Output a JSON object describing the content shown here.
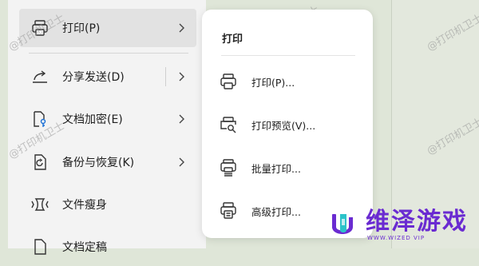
{
  "menu": {
    "items": [
      {
        "label": "打印(P)",
        "icon": "printer-icon",
        "has_submenu": true,
        "active": true
      },
      {
        "label": "分享发送(D)",
        "icon": "share-icon",
        "has_submenu": true,
        "active": false
      },
      {
        "label": "文档加密(E)",
        "icon": "document-lock-icon",
        "has_submenu": true,
        "active": false
      },
      {
        "label": "备份与恢复(K)",
        "icon": "backup-icon",
        "has_submenu": true,
        "active": false
      },
      {
        "label": "文件瘦身",
        "icon": "file-slim-icon",
        "has_submenu": false,
        "active": false
      },
      {
        "label": "文档定稿",
        "icon": "document-final-icon",
        "has_submenu": false,
        "active": false
      }
    ]
  },
  "submenu": {
    "title": "打印",
    "items": [
      {
        "label": "打印(P)...",
        "icon": "printer-icon"
      },
      {
        "label": "打印预览(V)...",
        "icon": "print-preview-icon"
      },
      {
        "label": "批量打印...",
        "icon": "batch-print-icon"
      },
      {
        "label": "高级打印...",
        "icon": "advanced-print-icon"
      }
    ]
  },
  "watermark_text": "@打印机卫士",
  "logo": {
    "name_cn": "维泽游戏",
    "name_en": "WWW.WIZED VIP",
    "color": "#6a2bd1"
  }
}
